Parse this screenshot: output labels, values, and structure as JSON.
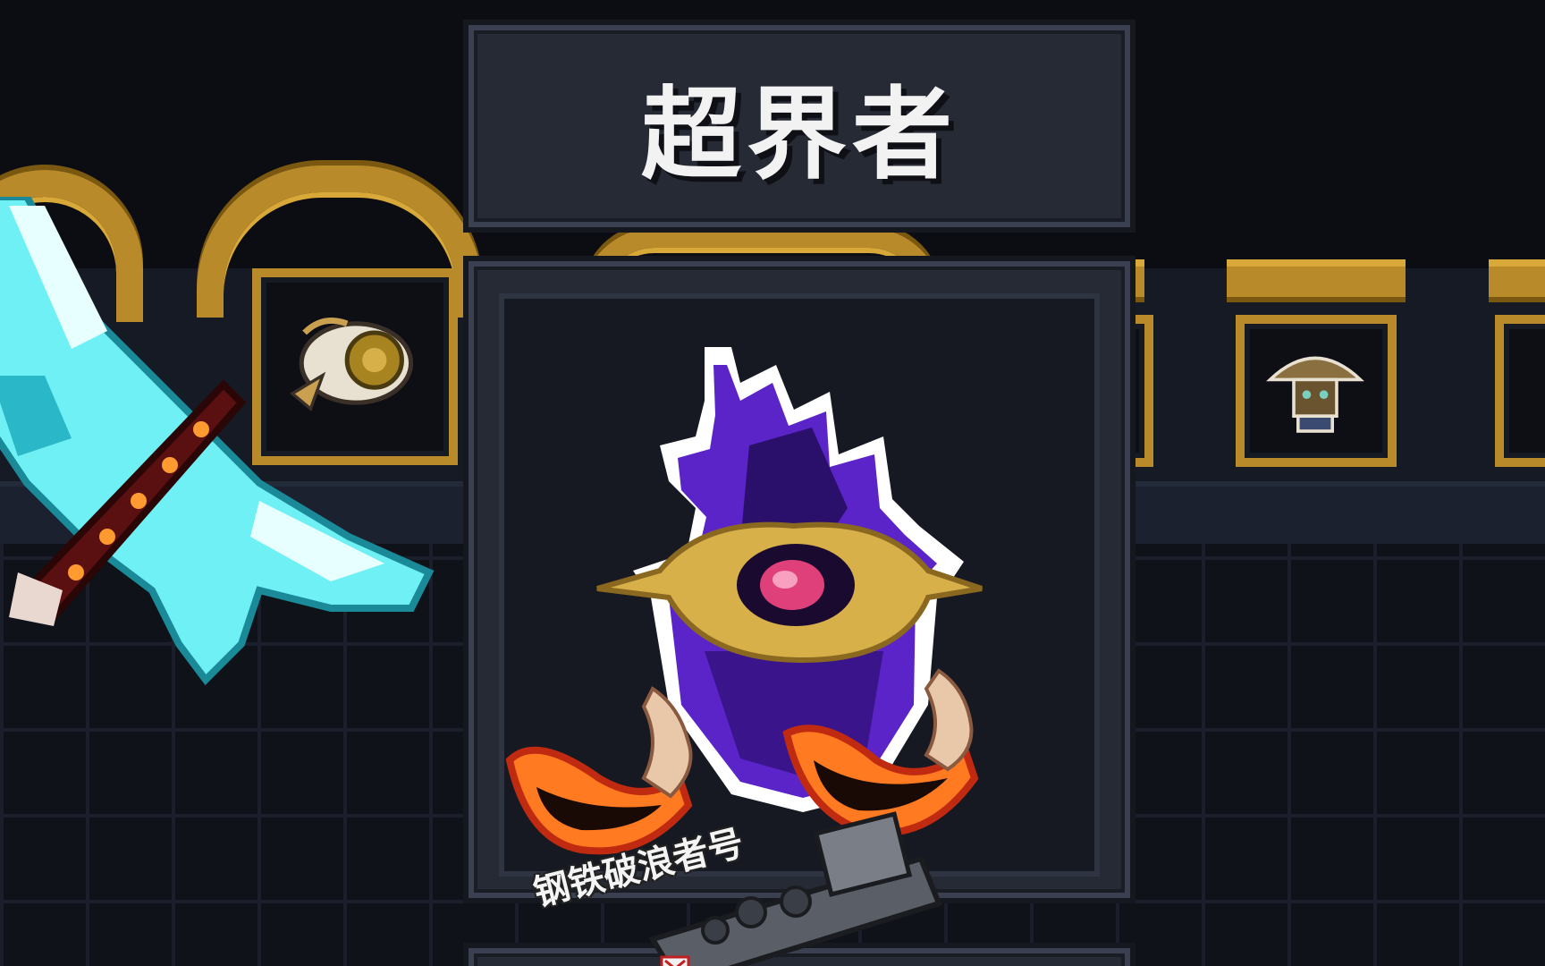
{
  "character_card": {
    "title": "超界者"
  },
  "sticker": {
    "caption": "钢铁破浪者号"
  },
  "colors": {
    "panel": "#262a35",
    "gold_frame": "#b88a2a",
    "hat_purple": "#5a24c8",
    "hat_gold": "#d8b04a",
    "gem_pink": "#e0407a",
    "crystal_cyan": "#6ef0f4"
  },
  "icons": {
    "hero_hat": "purple-jester-hat-with-gold-eye-mask",
    "left_slot": "golden-fish-relic",
    "right_slot": "mushroom-wizard",
    "left_weapon": "ice-crystal-sword",
    "spiked_club": "spiked-meat-club",
    "flaming_claws": "flaming-claw-hands",
    "battleship": "steel-battleship"
  }
}
